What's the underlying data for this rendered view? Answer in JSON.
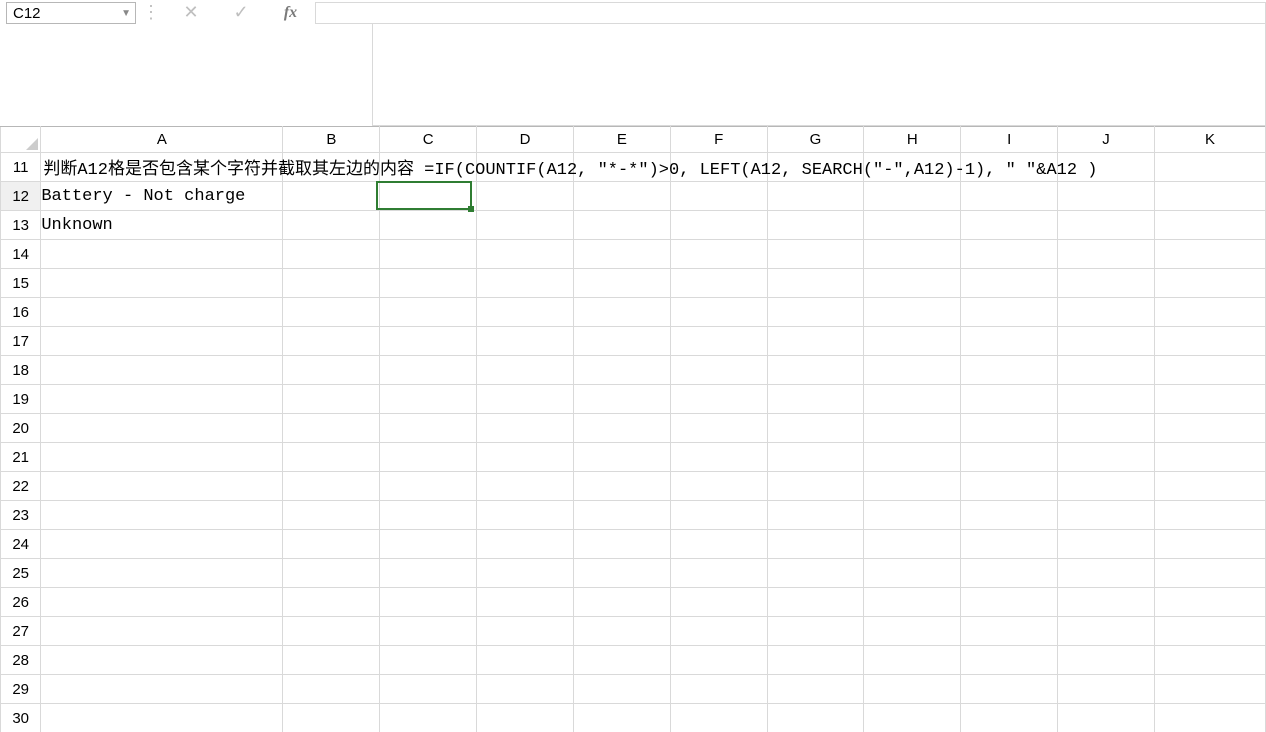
{
  "formula_bar": {
    "name_box_value": "C12",
    "fx_label": "fx",
    "formula_value": ""
  },
  "columns": [
    "A",
    "B",
    "C",
    "D",
    "E",
    "F",
    "G",
    "H",
    "I",
    "J",
    "K"
  ],
  "rows": [
    "11",
    "12",
    "13",
    "14",
    "15",
    "16",
    "17",
    "18",
    "19",
    "20",
    "21",
    "22",
    "23",
    "24",
    "25",
    "26",
    "27",
    "28",
    "29",
    "30"
  ],
  "selected_cell": "C12",
  "cells": {
    "A11": "判断A12格是否包含某个字符并截取其左边的内容 =IF(COUNTIF(A12, \"*-*\")>0, LEFT(A12, SEARCH(\"-\",A12)-1), \" \"&A12 )",
    "A12": "Battery - Not charge",
    "A13": "Unknown"
  }
}
